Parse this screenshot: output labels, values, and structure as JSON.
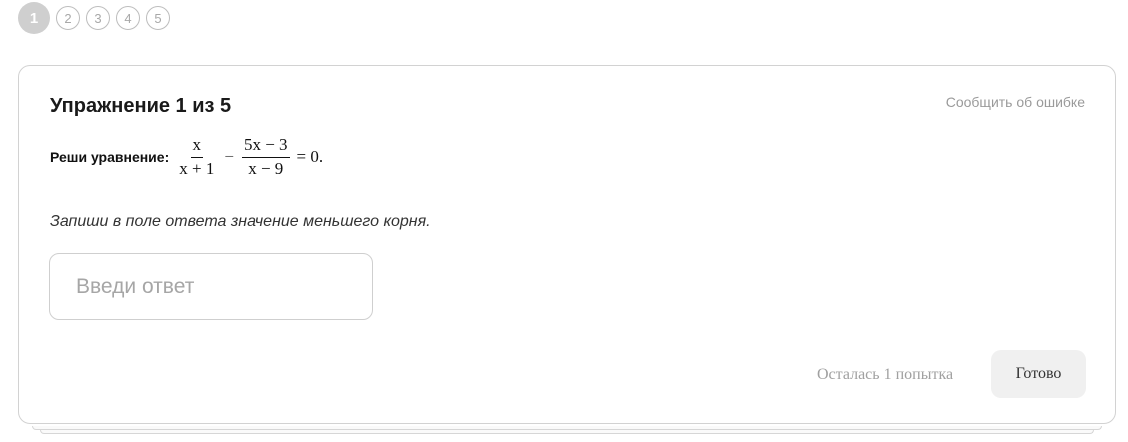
{
  "pager": {
    "steps": [
      "1",
      "2",
      "3",
      "4",
      "5"
    ],
    "active": "1"
  },
  "exercise": {
    "title": "Упражнение 1 из 5",
    "report_label": "Сообщить об ошибке",
    "problem_label": "Реши уравнение:",
    "equation": {
      "frac1_num": "x",
      "frac1_den": "x + 1",
      "minus": "−",
      "frac2_num": "5x − 3",
      "frac2_den": "x − 9",
      "rhs": "= 0."
    },
    "instruction": "Запиши в поле ответа значение меньшего корня.",
    "answer_placeholder": "Введи ответ",
    "answer_value": ""
  },
  "footer": {
    "attempts_text": "Осталась 1 попытка",
    "done_label": "Готово"
  }
}
